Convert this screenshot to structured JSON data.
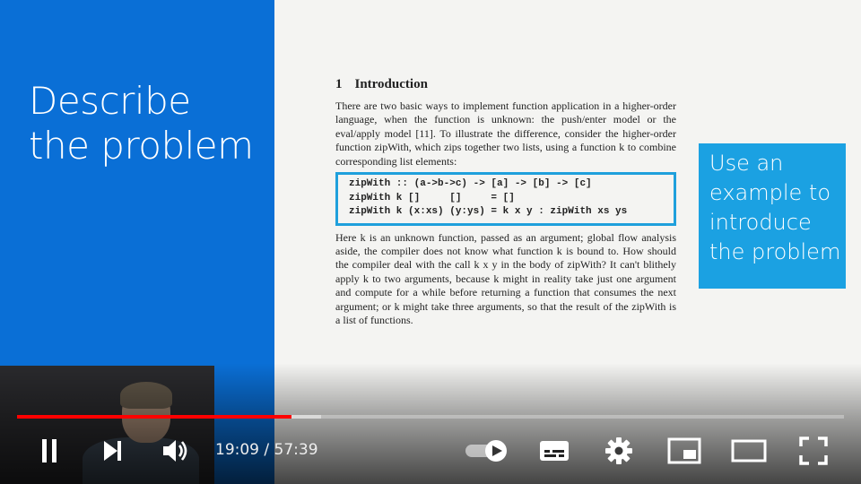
{
  "slide": {
    "title_lines": [
      "Describe",
      "the problem"
    ],
    "callout_lines": [
      "Use an",
      "example to",
      "introduce",
      "the problem"
    ],
    "paper": {
      "section_number": "1",
      "section_title": "Introduction",
      "para1": "There are two basic ways to implement function application in a higher-order language, when the function is unknown: the push/enter model or the eval/apply model [11]. To illustrate the difference, consider the higher-order function zipWith, which zips together two lists, using a function k to combine corresponding list elements:",
      "code": [
        "zipWith :: (a->b->c) -> [a] -> [b] -> [c]",
        "zipWith k []     []     = []",
        "zipWith k (x:xs) (y:ys) = k x y : zipWith xs ys"
      ],
      "para2": "Here k is an unknown function, passed as an argument; global flow analysis aside, the compiler does not know what function k is bound to. How should the compiler deal with the call k x y in the body of zipWith? It can't blithely apply k to two arguments, because k might in reality take just one argument and compute for a while before returning a function that consumes the next argument; or k might take three arguments, so that the result of the zipWith is a list of functions."
    }
  },
  "player": {
    "current_time": "19:09",
    "separator": " / ",
    "duration": "57:39",
    "played_fraction": 0.332,
    "buffered_fraction": 0.368,
    "colors": {
      "played": "#ff0000",
      "slide_blue": "#0a6fd6",
      "callout_blue": "#1ba1e2"
    },
    "controls": {
      "play_pause": "pause-icon",
      "next": "next-icon",
      "volume": "volume-icon",
      "autoplay": "autoplay-toggle-icon",
      "captions": "captions-icon",
      "settings": "gear-icon",
      "miniplayer": "miniplayer-icon",
      "theater": "theater-mode-icon",
      "fullscreen": "fullscreen-icon"
    }
  }
}
